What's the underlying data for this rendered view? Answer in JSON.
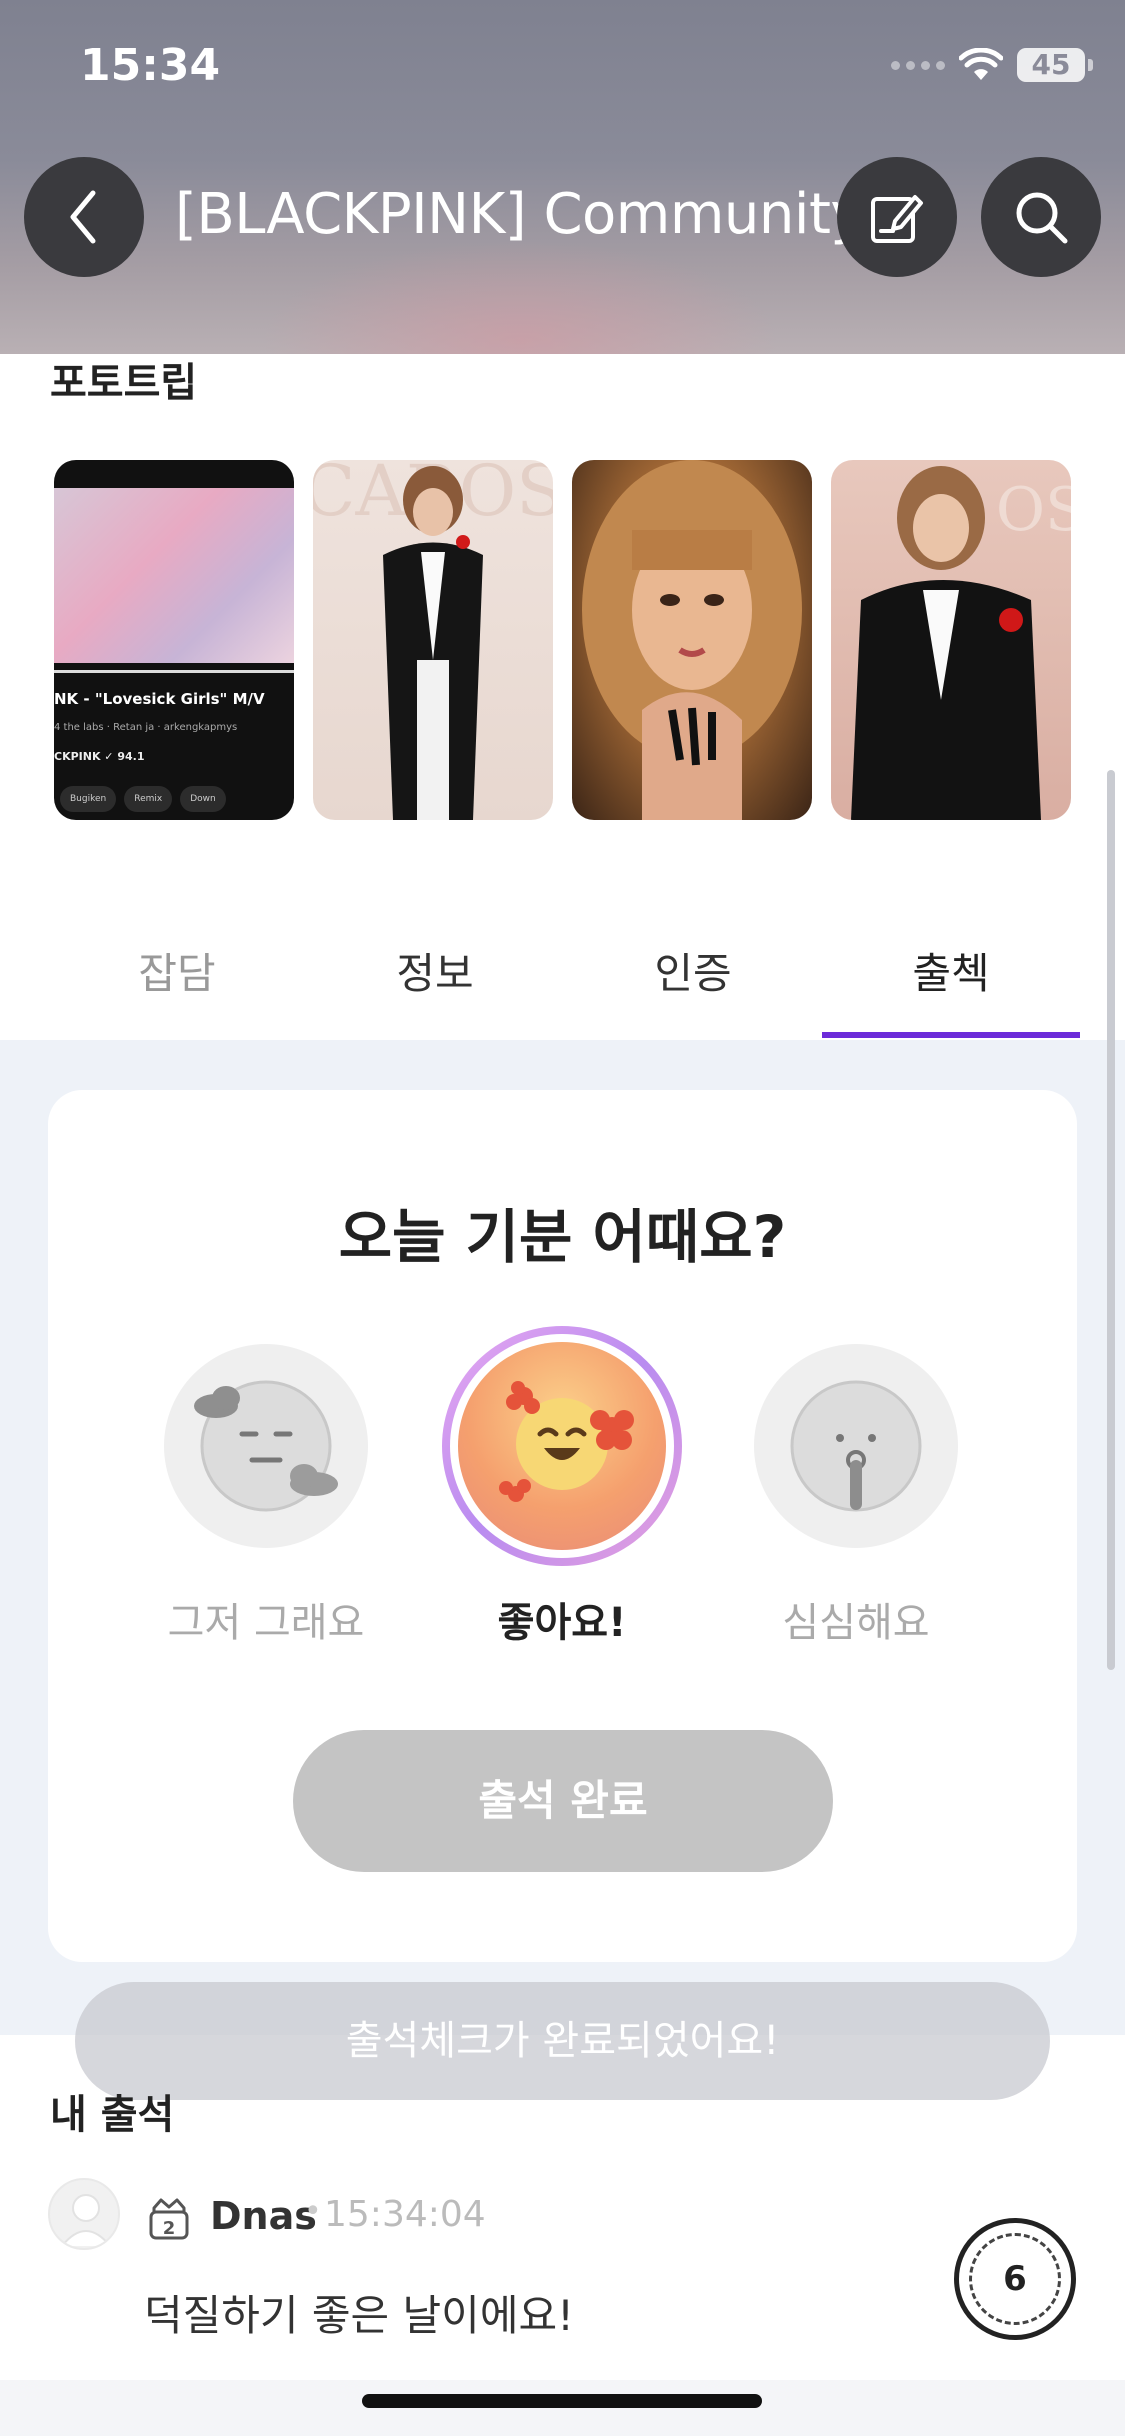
{
  "status": {
    "time": "15:34",
    "battery": "45"
  },
  "header": {
    "title": "[BLACKPINK] Community"
  },
  "phototips": {
    "title": "포토트립",
    "thumb1": {
      "title": "NK - \"Lovesick Girls\" M/V",
      "meta": "4 the labs · Retan ja · arkengkapmys",
      "channel": "CKPINK ✓ 94.1",
      "pills": [
        "Bugiken",
        "Remix",
        "Down"
      ]
    }
  },
  "tabs": [
    "잡담",
    "정보",
    "인증",
    "출첵"
  ],
  "active_tab": "출첵",
  "attendance": {
    "question": "오늘 기분 어때요?",
    "moods": [
      {
        "label": "그저 그래요"
      },
      {
        "label": "좋아요!"
      },
      {
        "label": "심심해요"
      }
    ],
    "selected_mood": "좋아요!",
    "button_label": "출석 완료"
  },
  "toast": "출석체크가 완료되었어요!",
  "my_attendance": {
    "title": "내 출석",
    "comment": {
      "level": "2",
      "name": "Dnas",
      "time": "15:34:04",
      "text": "덕질하기 좋은 날이에요!"
    }
  },
  "floating_badge": "6",
  "colors": {
    "accent": "#6c2bd9",
    "button_disabled": "#c4c4c4",
    "page_bg": "#eef2f8"
  }
}
